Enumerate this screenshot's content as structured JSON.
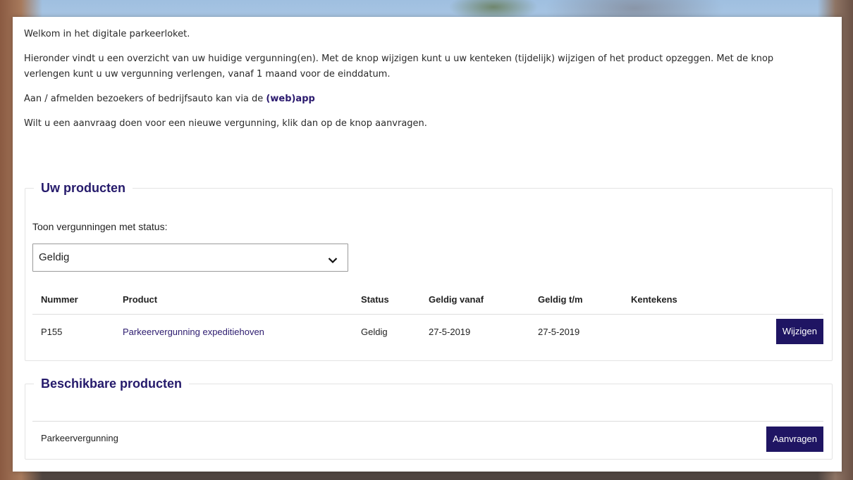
{
  "intro": {
    "welcome": "Welkom in het digitale parkeerloket.",
    "overview": "Hieronder vindt u een overzicht van uw huidige vergunning(en).  Met de knop wijzigen kunt u uw kenteken (tijdelijk) wijzigen of het product opzeggen. Met de knop verlengen kunt u uw vergunning verlengen, vanaf 1 maand voor de einddatum.",
    "visitors_prefix": "Aan / afmelden bezoekers of bedrijfsauto kan via de ",
    "webapp_link": "(web)app",
    "new_request": "Wilt u een aanvraag doen voor een nieuwe vergunning, klik dan op de knop aanvragen."
  },
  "products": {
    "title": "Uw producten",
    "status_label": "Toon vergunningen met status:",
    "status_selected": "Geldig",
    "columns": [
      "Nummer",
      "Product",
      "Status",
      "Geldig vanaf",
      "Geldig t/m",
      "Kentekens"
    ],
    "rows": [
      {
        "nummer": "P155",
        "product": "Parkeervergunning expeditiehoven",
        "status": "Geldig",
        "vanaf": "27-5-2019",
        "tm": "27-5-2019",
        "kentekens": "",
        "button": "Wijzigen"
      }
    ]
  },
  "available": {
    "title": "Beschikbare producten",
    "items": [
      {
        "name": "Parkeervergunning",
        "button": "Aanvragen"
      }
    ]
  },
  "colors": {
    "accent": "#1f1563",
    "heading": "#251a6b"
  },
  "icons": {
    "select_chevron": "chevron-down-icon"
  }
}
